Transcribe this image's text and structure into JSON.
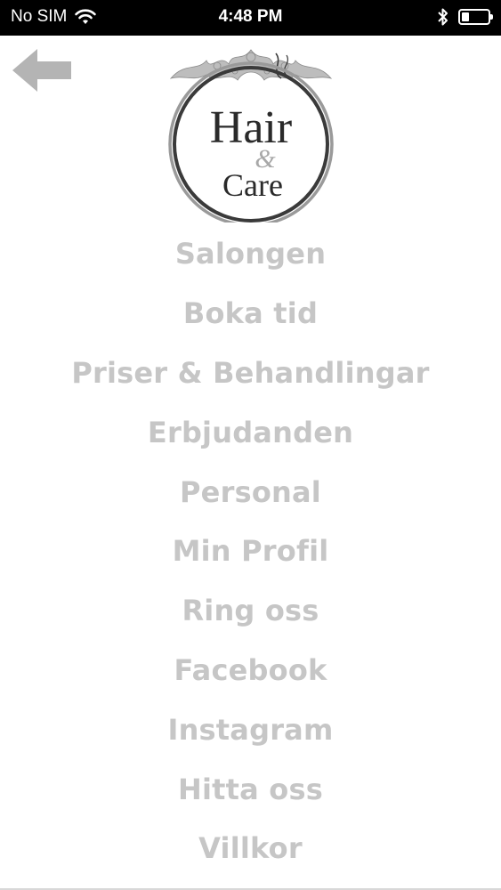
{
  "status_bar": {
    "carrier": "No SIM",
    "time": "4:48 PM",
    "battery_level": 0.3,
    "icons": [
      "wifi-icon",
      "bluetooth-icon",
      "battery-icon"
    ]
  },
  "header": {
    "back_icon": "back-arrow-icon",
    "logo": {
      "line1": "Hair",
      "ampersand": "&",
      "line2": "Care"
    }
  },
  "menu": {
    "items": [
      {
        "label": "Salongen"
      },
      {
        "label": "Boka tid"
      },
      {
        "label": "Priser & Behandlingar"
      },
      {
        "label": "Erbjudanden"
      },
      {
        "label": "Personal"
      },
      {
        "label": "Min Profil"
      },
      {
        "label": "Ring oss"
      },
      {
        "label": "Facebook"
      },
      {
        "label": "Instagram"
      },
      {
        "label": "Hitta oss"
      },
      {
        "label": "Villkor"
      }
    ]
  },
  "colors": {
    "menu_text": "#c6c6c6",
    "status_bar_bg": "#000000",
    "back_arrow": "#b4b4b4",
    "logo_ring": "#3a3a3a"
  }
}
